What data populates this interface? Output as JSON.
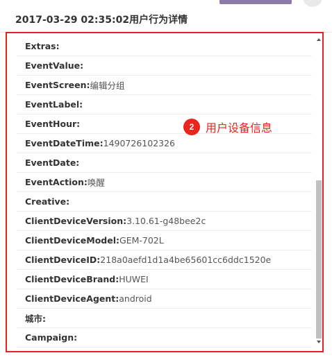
{
  "modal": {
    "title": "2017-03-29 02:35:02用户行为详情"
  },
  "details": [
    {
      "key": "Extras:",
      "value": ""
    },
    {
      "key": "EventValue:",
      "value": ""
    },
    {
      "key": "EventScreen:",
      "value": "编辑分组"
    },
    {
      "key": "EventLabel:",
      "value": ""
    },
    {
      "key": "EventHour:",
      "value": ""
    },
    {
      "key": "EventDateTime:",
      "value": "1490726102326"
    },
    {
      "key": "EventDate:",
      "value": ""
    },
    {
      "key": "EventAction:",
      "value": "唤醒"
    },
    {
      "key": "Creative:",
      "value": ""
    },
    {
      "key": "ClientDeviceVersion:",
      "value": "3.10.61-g48bee2c"
    },
    {
      "key": "ClientDeviceModel:",
      "value": "GEM-702L"
    },
    {
      "key": "ClientDeviceID:",
      "value": "218a0aefd1d1a4be65601cc6ddc1520e"
    },
    {
      "key": "ClientDeviceBrand:",
      "value": "HUWEI"
    },
    {
      "key": "ClientDeviceAgent:",
      "value": "android"
    },
    {
      "key": "城市:",
      "value": ""
    },
    {
      "key": "Campaign:",
      "value": ""
    }
  ],
  "annotation": {
    "number": "2",
    "label": "用户设备信息",
    "color": "#e8261e"
  },
  "colors": {
    "highlight_border": "#e02424",
    "row_divider": "#ececec"
  }
}
